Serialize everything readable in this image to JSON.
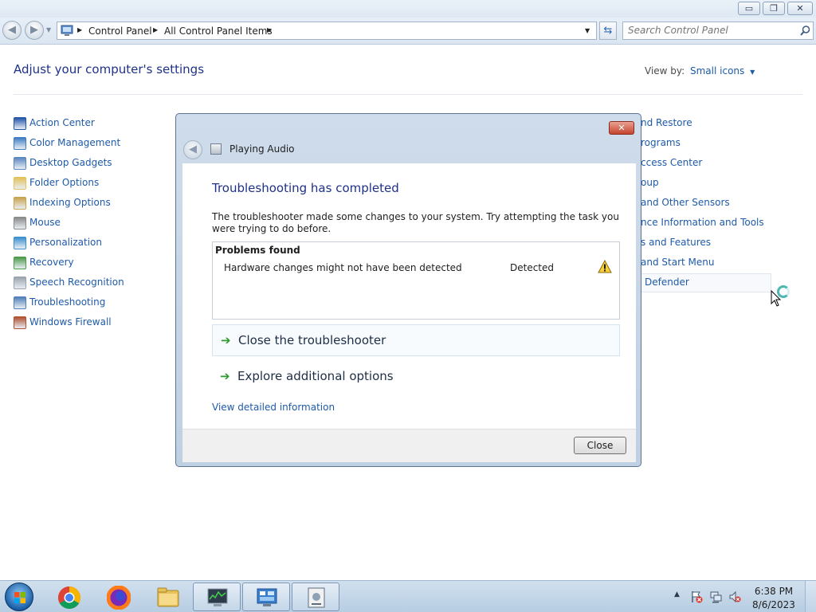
{
  "window": {
    "controls": {
      "minimize": "▭",
      "maximize": "❐",
      "close": "✕"
    }
  },
  "navigation": {
    "back_icon": "back-arrow-icon",
    "forward_icon": "forward-arrow-icon",
    "breadcrumb": [
      "Control Panel",
      "All Control Panel Items"
    ],
    "search_placeholder": "Search Control Panel"
  },
  "control_panel": {
    "title": "Adjust your computer's settings",
    "view_by_label": "View by:",
    "view_by_value": "Small icons",
    "left_items": [
      {
        "label": "Action Center",
        "icon": "action-center-flag-icon",
        "color": "#2355a8"
      },
      {
        "label": "Color Management",
        "icon": "color-management-icon",
        "color": "#3f7cc4"
      },
      {
        "label": "Desktop Gadgets",
        "icon": "desktop-gadgets-icon",
        "color": "#5b86c0"
      },
      {
        "label": "Folder Options",
        "icon": "folder-options-icon",
        "color": "#e3c25a"
      },
      {
        "label": "Indexing Options",
        "icon": "indexing-options-icon",
        "color": "#c9a44e"
      },
      {
        "label": "Mouse",
        "icon": "mouse-icon",
        "color": "#8a8a8a"
      },
      {
        "label": "Personalization",
        "icon": "personalization-icon",
        "color": "#3a8fd0"
      },
      {
        "label": "Recovery",
        "icon": "recovery-icon",
        "color": "#4b9b4b"
      },
      {
        "label": "Speech Recognition",
        "icon": "microphone-icon",
        "color": "#9aa3ad"
      },
      {
        "label": "Troubleshooting",
        "icon": "troubleshooting-icon",
        "color": "#4f7fb8"
      },
      {
        "label": "Windows Firewall",
        "icon": "windows-firewall-icon",
        "color": "#b0502f"
      }
    ],
    "right_items_partial": [
      "nd Restore",
      "rograms",
      "ccess Center",
      "oup",
      "and Other Sensors",
      "nce Information and Tools",
      "s and Features",
      "and Start Menu",
      "Defender"
    ]
  },
  "dialog": {
    "title": "Playing Audio",
    "heading": "Troubleshooting has completed",
    "description": "The troubleshooter made some changes to your system. Try attempting the task you were trying to do before.",
    "problems_header": "Problems found",
    "problems": [
      {
        "description": "Hardware changes might not have been detected",
        "status": "Detected",
        "icon": "warning-icon"
      }
    ],
    "options": [
      {
        "label": "Close the troubleshooter",
        "icon": "green-arrow-icon"
      },
      {
        "label": "Explore additional options",
        "icon": "green-arrow-icon"
      }
    ],
    "detail_link": "View detailed information",
    "close_button": "Close"
  },
  "taskbar": {
    "pinned": [
      "chrome-icon",
      "firefox-icon",
      "file-explorer-icon",
      "task-manager-icon",
      "control-panel-icon",
      "troubleshooter-icon"
    ],
    "clock": {
      "time": "6:38 PM",
      "date": "8/6/2023"
    },
    "tray_icons": [
      "show-hidden-icons-chevron",
      "action-center-tray-icon",
      "network-tray-icon",
      "volume-muted-icon"
    ]
  }
}
